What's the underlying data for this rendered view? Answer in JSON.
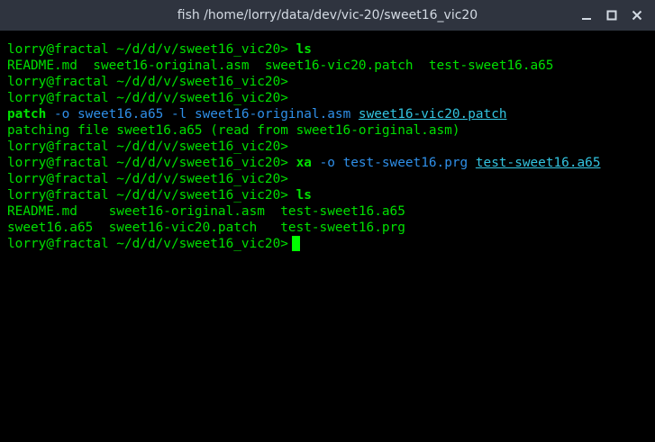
{
  "window": {
    "title": "fish /home/lorry/data/dev/vic-20/sweet16_vic20",
    "controls": [
      "minimize-icon",
      "maximize-icon",
      "close-icon"
    ]
  },
  "terminal": {
    "prompt": "lorry@fractal ~/d/d/v/sweet16_vic20>",
    "lines": [
      {
        "type": "command",
        "cmd": "ls",
        "args": "",
        "file": ""
      },
      {
        "type": "output",
        "text": "README.md  sweet16-original.asm  sweet16-vic20.patch  test-sweet16.a65"
      },
      {
        "type": "prompt"
      },
      {
        "type": "prompt"
      },
      {
        "type": "output-cmd",
        "cmd": "patch",
        "args": "-o sweet16.a65 -l sweet16-original.asm",
        "file": "sweet16-vic20.patch"
      },
      {
        "type": "output",
        "text": "patching file sweet16.a65 (read from sweet16-original.asm)"
      },
      {
        "type": "prompt"
      },
      {
        "type": "command",
        "cmd": "xa",
        "args": "-o test-sweet16.prg",
        "file": "test-sweet16.a65"
      },
      {
        "type": "prompt"
      },
      {
        "type": "command",
        "cmd": "ls",
        "args": "",
        "file": ""
      },
      {
        "type": "output",
        "text": "README.md    sweet16-original.asm  test-sweet16.a65"
      },
      {
        "type": "output",
        "text": "sweet16.a65  sweet16-vic20.patch   test-sweet16.prg"
      },
      {
        "type": "cursor"
      }
    ]
  }
}
